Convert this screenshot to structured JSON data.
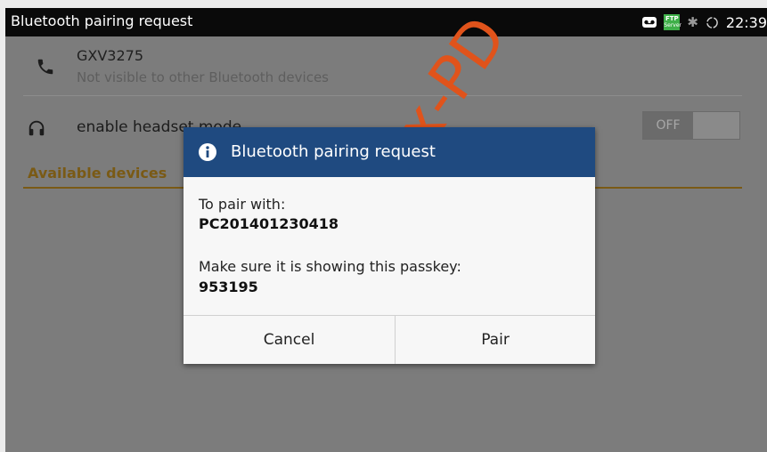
{
  "status_bar": {
    "title": "Bluetooth pairing request",
    "time": "22:39",
    "ftp_text_top": "FTP",
    "ftp_text_bottom": "Server"
  },
  "settings": {
    "device": {
      "name": "GXV3275",
      "subtitle": "Not visible to other Bluetooth devices"
    },
    "headset": {
      "label": "enable headset mode",
      "toggle_state": "OFF"
    },
    "section_label": "Available devices"
  },
  "dialog": {
    "title": "Bluetooth pairing request",
    "pair_with_label": "To pair with:",
    "pair_with_value": "PC201401230418",
    "passkey_label": "Make sure it is showing this passkey:",
    "passkey_value": "953195",
    "cancel_label": "Cancel",
    "pair_label": "Pair"
  },
  "watermark": {
    "text": "x-PD"
  },
  "colors": {
    "header_blue": "#1f4a80",
    "section_gold": "#7a5a15",
    "ftp_green": "#3fb049",
    "watermark": "#e0531b"
  }
}
